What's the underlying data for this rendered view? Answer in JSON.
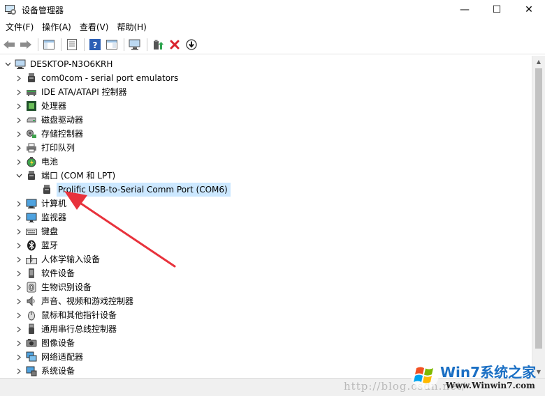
{
  "window": {
    "title": "设备管理器",
    "minimize": "—",
    "maximize": "☐",
    "close": "✕"
  },
  "menu": [
    {
      "label": "文件(F)"
    },
    {
      "label": "操作(A)"
    },
    {
      "label": "查看(V)"
    },
    {
      "label": "帮助(H)"
    }
  ],
  "tree": {
    "root": {
      "label": "DESKTOP-N3O6KRH",
      "expanded": true
    },
    "items": [
      {
        "label": "com0com - serial port emulators",
        "icon": "port-icon"
      },
      {
        "label": "IDE ATA/ATAPI 控制器",
        "icon": "ide-icon"
      },
      {
        "label": "处理器",
        "icon": "cpu-icon"
      },
      {
        "label": "磁盘驱动器",
        "icon": "disk-icon"
      },
      {
        "label": "存储控制器",
        "icon": "storage-icon"
      },
      {
        "label": "打印队列",
        "icon": "printer-icon"
      },
      {
        "label": "电池",
        "icon": "battery-icon"
      },
      {
        "label": "端口 (COM 和 LPT)",
        "icon": "port-icon",
        "expanded": true
      },
      {
        "label": "Prolific USB-to-Serial Comm Port (COM6)",
        "icon": "port-icon",
        "child": true,
        "selected": true
      },
      {
        "label": "计算机",
        "icon": "computer-icon"
      },
      {
        "label": "监视器",
        "icon": "monitor-icon"
      },
      {
        "label": "键盘",
        "icon": "keyboard-icon"
      },
      {
        "label": "蓝牙",
        "icon": "bluetooth-icon"
      },
      {
        "label": "人体学输入设备",
        "icon": "hid-icon"
      },
      {
        "label": "软件设备",
        "icon": "software-device-icon"
      },
      {
        "label": "生物识别设备",
        "icon": "fingerprint-icon"
      },
      {
        "label": "声音、视频和游戏控制器",
        "icon": "speaker-icon"
      },
      {
        "label": "鼠标和其他指针设备",
        "icon": "mouse-icon"
      },
      {
        "label": "通用串行总线控制器",
        "icon": "usb-icon"
      },
      {
        "label": "图像设备",
        "icon": "camera-icon"
      },
      {
        "label": "网络适配器",
        "icon": "network-icon"
      },
      {
        "label": "系统设备",
        "icon": "system-icon"
      }
    ]
  },
  "watermark": {
    "url": "http://blog.csdn.net/",
    "title": "Win7系统之家",
    "subtitle": "Www.Winwin7.com"
  },
  "colors": {
    "selection": "#cce8ff",
    "arrow": "#e8323c",
    "accent": "#1a6fc4"
  }
}
